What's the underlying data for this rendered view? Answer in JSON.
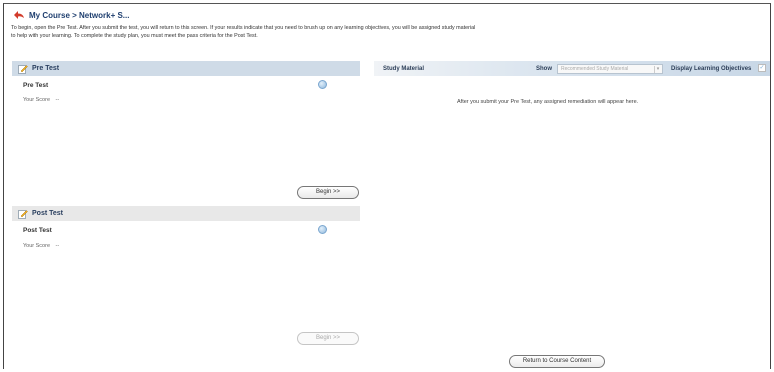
{
  "breadcrumb": {
    "text": "My Course > Network+ S..."
  },
  "intro": {
    "line1": "To begin, open the Pre Test. After you submit the test, you will return to this screen. If your results indicate that you need to brush up on any learning objectives, you will be assigned study material",
    "line2": "to help with your learning. To complete the study plan, you must meet the pass criteria for the Post Test."
  },
  "pre_test": {
    "header": "Pre Test",
    "title": "Pre Test",
    "score_label": "Your Score",
    "score_value": "--",
    "begin_label": "Begin >>"
  },
  "post_test": {
    "header": "Post Test",
    "title": "Post Test",
    "score_label": "Your Score",
    "score_value": "--",
    "begin_label": "Begin >>"
  },
  "study": {
    "title": "Study Material",
    "show_label": "Show",
    "show_selected": "Recommended Study Material",
    "objectives_label": "Display Learning Objectives",
    "remediation_text": "After you submit your Pre Test, any assigned remediation will appear here."
  },
  "footer": {
    "return_label": "Return to Course Content"
  },
  "icons": {
    "back": "back-arrow-icon",
    "pencil": "pencil-icon",
    "info": "info-icon"
  },
  "colors": {
    "accent": "#1f3f6f",
    "pre_header_bg": "#cfdbe7",
    "post_header_bg": "#e8e8e8",
    "back_icon": "#d23b2b"
  }
}
